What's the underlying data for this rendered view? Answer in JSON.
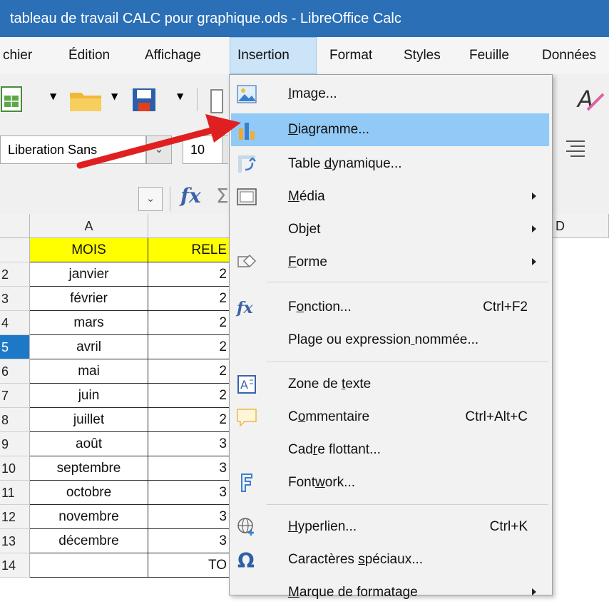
{
  "window": {
    "title": "tableau de travail CALC pour graphique.ods - LibreOffice Calc"
  },
  "menubar": {
    "items": [
      "chier",
      "Édition",
      "Affichage",
      "Insertion",
      "Format",
      "Styles",
      "Feuille",
      "Données"
    ],
    "active": "Insertion"
  },
  "toolbar": {
    "font_name": "Liberation Sans",
    "font_size": "10"
  },
  "formula_bar": {
    "fx": "fx",
    "sigma": "Σ"
  },
  "grid": {
    "columns": [
      "A",
      "",
      "D"
    ],
    "rows": [
      {
        "num": "",
        "a": "MOIS",
        "b": "RELE"
      },
      {
        "num": "2",
        "a": "janvier",
        "b": "2"
      },
      {
        "num": "3",
        "a": "février",
        "b": "2"
      },
      {
        "num": "4",
        "a": "mars",
        "b": "2"
      },
      {
        "num": "5",
        "a": "avril",
        "b": "2"
      },
      {
        "num": "6",
        "a": "mai",
        "b": "2"
      },
      {
        "num": "7",
        "a": "juin",
        "b": "2"
      },
      {
        "num": "8",
        "a": "juillet",
        "b": "2"
      },
      {
        "num": "9",
        "a": "août",
        "b": "3"
      },
      {
        "num": "10",
        "a": "septembre",
        "b": "3"
      },
      {
        "num": "11",
        "a": "octobre",
        "b": "3"
      },
      {
        "num": "12",
        "a": "novembre",
        "b": "3"
      },
      {
        "num": "13",
        "a": "décembre",
        "b": "3"
      },
      {
        "num": "14",
        "a": "",
        "b": "TO"
      }
    ],
    "selected_row": "5"
  },
  "insert_menu": {
    "items": [
      {
        "label": "Image...",
        "icon": "image-icon"
      },
      {
        "label": "Diagramme...",
        "icon": "chart-icon",
        "highlighted": true
      },
      {
        "label": "Table dynamique...",
        "icon": "pivot-table-icon"
      },
      {
        "label": "Média",
        "icon": "media-icon",
        "submenu": true
      },
      {
        "label": "Objet",
        "submenu": true
      },
      {
        "label": "Forme",
        "icon": "shape-icon",
        "submenu": true
      },
      {
        "label": "Fonction...",
        "icon": "function-icon",
        "shortcut": "Ctrl+F2"
      },
      {
        "label": "Plage ou expression nommée..."
      },
      {
        "label": "Zone de texte",
        "icon": "text-box-icon"
      },
      {
        "label": "Commentaire",
        "icon": "comment-icon",
        "shortcut": "Ctrl+Alt+C"
      },
      {
        "label": "Cadre flottant..."
      },
      {
        "label": "Fontwork...",
        "icon": "fontwork-icon"
      },
      {
        "label": "Hyperlien...",
        "icon": "hyperlink-icon",
        "shortcut": "Ctrl+K"
      },
      {
        "label": "Caractères spéciaux...",
        "icon": "special-character-icon"
      },
      {
        "label": "Marque de formatage",
        "submenu": true
      }
    ]
  },
  "colors": {
    "titlebar": "#2b6fb6",
    "highlight": "#91c9f7",
    "header_yellow": "#ffff00",
    "arrow": "#e02020"
  }
}
